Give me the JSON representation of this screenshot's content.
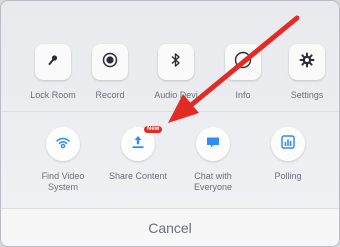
{
  "actions_row1": [
    {
      "label": "Lock Room",
      "icon": "lock-icon"
    },
    {
      "label": "Record",
      "icon": "record-icon"
    },
    {
      "label": "Audio Devi",
      "icon": "bluetooth-icon"
    },
    {
      "label": "Info",
      "icon": "info-icon"
    },
    {
      "label": "Settings",
      "icon": "gear-icon"
    }
  ],
  "actions_row2": [
    {
      "label": "Find Video System",
      "icon": "wifi-icon"
    },
    {
      "label": "Share Content",
      "icon": "share-upload-icon",
      "badge": "New"
    },
    {
      "label": "Chat with Everyone",
      "icon": "chat-bubble-icon"
    },
    {
      "label": "Polling",
      "icon": "poll-chart-icon"
    }
  ],
  "cancel_label": "Cancel",
  "colors": {
    "accent": "#2d8cff",
    "badge": "#e22b25",
    "arrow": "#e22b25",
    "icon_dark": "#2b2d33",
    "label_grey": "#6b6f78"
  }
}
